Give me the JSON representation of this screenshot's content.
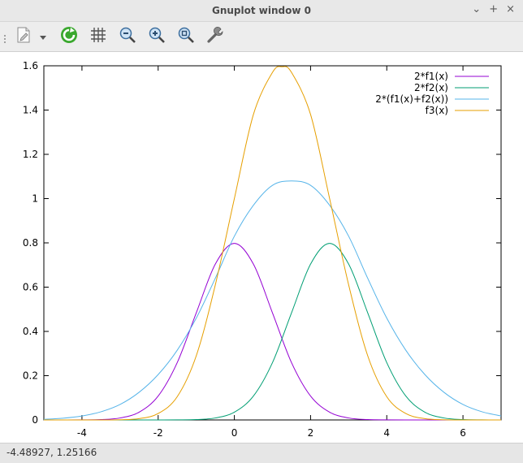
{
  "window": {
    "title": "Gnuplot window 0",
    "controls": [
      "⌄",
      "+",
      "×"
    ]
  },
  "toolbar": {
    "icons": [
      "export-icon",
      "dropdown-icon",
      "replot-icon",
      "grid-icon",
      "zoom-out-icon",
      "zoom-in-icon",
      "zoom-fit-icon",
      "settings-icon"
    ]
  },
  "status": {
    "coordinates": "-4.48927,  1.25166"
  },
  "chart_data": {
    "type": "line",
    "xlim": [
      -5,
      7
    ],
    "ylim": [
      0,
      1.6
    ],
    "xticks": [
      -4,
      -2,
      0,
      2,
      4,
      6
    ],
    "xtick_labels": [
      "-4",
      "-2",
      "0",
      "2",
      "4",
      "6"
    ],
    "yticks": [
      0,
      0.2,
      0.4,
      0.6,
      0.8,
      1.0,
      1.2,
      1.4,
      1.6
    ],
    "ytick_labels": [
      "0",
      "0.2",
      "0.4",
      "0.6",
      "0.8",
      "1",
      "1.2",
      "1.4",
      "1.6"
    ],
    "legend_position": "top-right",
    "series": [
      {
        "name": "2*f1(x)",
        "color": "#9400d3",
        "x": [
          -5,
          -4.5,
          -4,
          -3.5,
          -3,
          -2.5,
          -2,
          -1.5,
          -1,
          -0.5,
          0,
          0.5,
          1,
          1.5,
          2,
          2.5,
          3,
          3.5,
          4,
          4.5,
          5,
          5.5,
          6,
          6.5,
          7
        ],
        "y": [
          0.0,
          0.0,
          0.0003,
          0.0017,
          0.0089,
          0.035,
          0.108,
          0.259,
          0.4839,
          0.7041,
          0.7979,
          0.7041,
          0.4839,
          0.259,
          0.108,
          0.035,
          0.0089,
          0.0017,
          0.0003,
          0.0,
          0.0,
          0.0,
          0.0,
          0.0,
          0.0
        ]
      },
      {
        "name": "2*f2(x)",
        "color": "#009e73",
        "x": [
          -5,
          -4.5,
          -4,
          -3.5,
          -3,
          -2.5,
          -2,
          -1.5,
          -1,
          -0.5,
          0,
          0.5,
          1,
          1.5,
          2,
          2.5,
          3,
          3.5,
          4,
          4.5,
          5,
          5.5,
          6,
          6.5,
          7
        ],
        "y": [
          0.0,
          0.0,
          0.0,
          0.0,
          0.0,
          0.0,
          0.0,
          0.0003,
          0.0017,
          0.0089,
          0.035,
          0.108,
          0.259,
          0.4839,
          0.7041,
          0.7979,
          0.7041,
          0.4839,
          0.259,
          0.108,
          0.035,
          0.0089,
          0.0017,
          0.0003,
          0.0
        ]
      },
      {
        "name": "2*(f1(x)+f2(x))",
        "color": "#56b4e9",
        "x": [
          -5,
          -4.5,
          -4,
          -3.5,
          -3,
          -2.5,
          -2,
          -1.5,
          -1,
          -0.5,
          0,
          0.5,
          1,
          1.5,
          2,
          2.5,
          3,
          3.5,
          4,
          4.5,
          5,
          5.5,
          6,
          6.5,
          7
        ],
        "y": [
          0.003,
          0.008,
          0.018,
          0.037,
          0.07,
          0.125,
          0.205,
          0.315,
          0.46,
          0.64,
          0.83,
          0.97,
          1.06,
          1.08,
          1.06,
          0.97,
          0.83,
          0.64,
          0.46,
          0.315,
          0.205,
          0.125,
          0.07,
          0.037,
          0.018
        ]
      },
      {
        "name": "f3(x)",
        "color": "#e69f00",
        "x": [
          -5,
          -4.5,
          -4,
          -3.5,
          -3,
          -2.5,
          -2,
          -1.5,
          -1,
          -0.5,
          0,
          0.5,
          1,
          1.25,
          1.5,
          2,
          2.5,
          3,
          3.5,
          4,
          4.5,
          5,
          5.5,
          6,
          6.5,
          7
        ],
        "y": [
          0.0,
          0.0,
          0.0,
          0.0001,
          0.0009,
          0.006,
          0.029,
          0.105,
          0.29,
          0.61,
          1.0,
          1.38,
          1.57,
          1.5958,
          1.57,
          1.38,
          1.0,
          0.61,
          0.29,
          0.105,
          0.029,
          0.006,
          0.0009,
          0.0001,
          0.0,
          0.0
        ]
      }
    ]
  }
}
